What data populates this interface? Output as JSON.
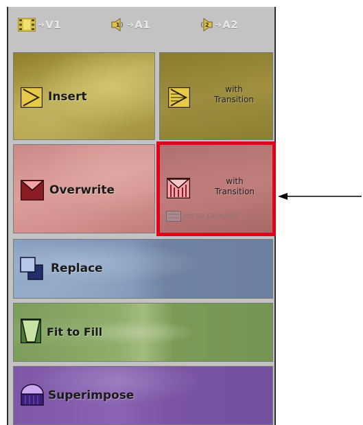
{
  "tracks": [
    {
      "label": "V1",
      "icon": "video-track-icon"
    },
    {
      "label": "A1",
      "icon": "audio-track-1-icon"
    },
    {
      "label": "A2",
      "icon": "audio-track-2-icon"
    }
  ],
  "insert": {
    "label": "Insert",
    "with_label": "with",
    "transition_label": "Transition"
  },
  "overwrite": {
    "label": "Overwrite",
    "with_label": "with",
    "transition_label": "Transition",
    "clip_name": "Jesse Jackson"
  },
  "replace": {
    "label": "Replace"
  },
  "fit_to_fill": {
    "label": "Fit to Fill"
  },
  "superimpose": {
    "label": "Superimpose"
  },
  "colors": {
    "insert": "#a89a40",
    "overwrite": "#c98784",
    "replace": "#6e82a4",
    "fit_to_fill": "#7e9e5a",
    "superimpose": "#7a53a3",
    "selection": "#e2001a"
  }
}
